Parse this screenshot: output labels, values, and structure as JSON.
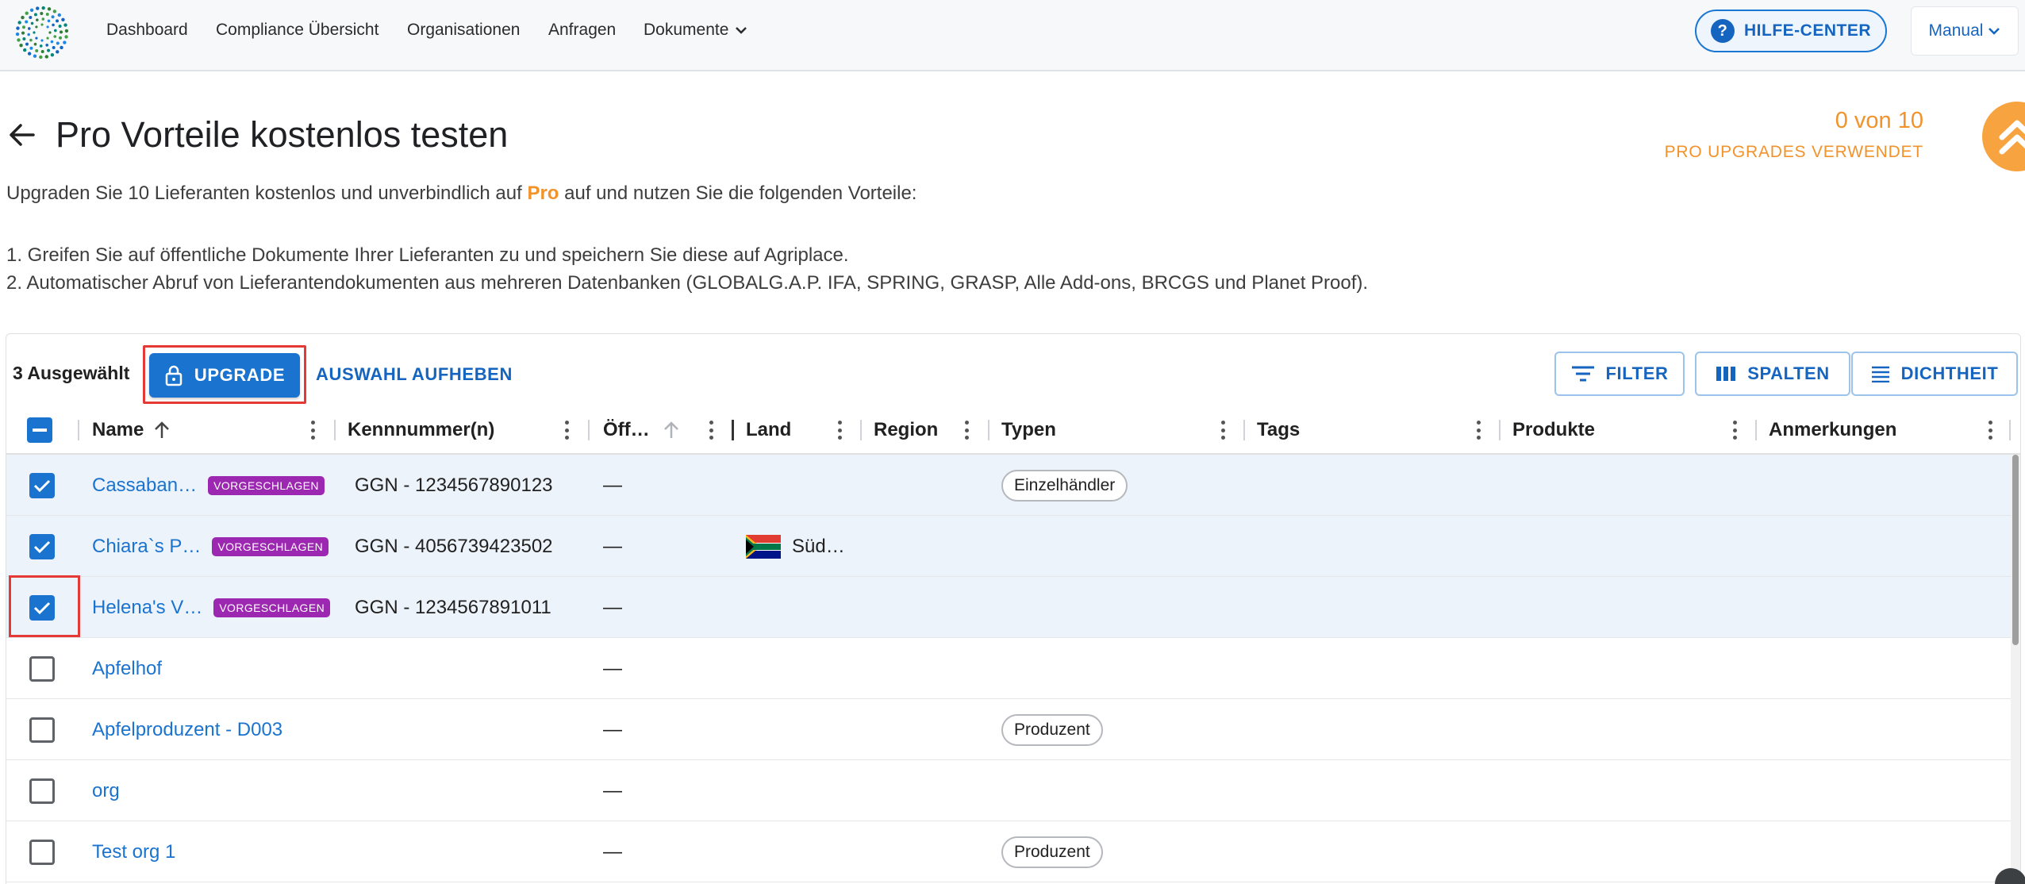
{
  "nav": {
    "items": [
      "Dashboard",
      "Compliance Übersicht",
      "Organisationen",
      "Anfragen",
      "Dokumente"
    ],
    "help_label": "HILFE-CENTER",
    "manual_label": "Manual"
  },
  "header": {
    "title": "Pro Vorteile kostenlos testen",
    "counter_value": "0 von 10",
    "counter_label": "PRO UPGRADES VERWENDET"
  },
  "intro": {
    "before": "Upgraden Sie 10 Lieferanten kostenlos und unverbindlich auf ",
    "pro": "Pro",
    "after": " auf und nutzen Sie die folgenden Vorteile:",
    "point1": "1. Greifen Sie auf öffentliche Dokumente Ihrer Lieferanten zu und speichern Sie diese auf Agriplace.",
    "point2": "2. Automatischer Abruf von Lieferantendokumenten aus mehreren Datenbanken (GLOBALG.A.P. IFA, SPRING, GRASP, Alle Add-ons, BRCGS und Planet Proof)."
  },
  "toolbar": {
    "selected_count": "3 Ausgewählt",
    "upgrade_label": "UPGRADE",
    "clear_label": "AUSWAHL AUFHEBEN",
    "filter_label": "FILTER",
    "columns_label": "SPALTEN",
    "density_label": "DICHTHEIT"
  },
  "columns": [
    "Name",
    "Kennnummer(n)",
    "Öff…",
    "Land",
    "Region",
    "Typen",
    "Tags",
    "Produkte",
    "Anmerkungen"
  ],
  "rows": [
    {
      "name": "Cassaban…",
      "badge": "VORGESCHLAGEN",
      "id": "GGN - 1234567890123",
      "pub": "—",
      "land": "",
      "typ": "Einzelhändler",
      "checked": true
    },
    {
      "name": "Chiara`s P…",
      "badge": "VORGESCHLAGEN",
      "id": "GGN - 4056739423502",
      "pub": "—",
      "land": "Süd…",
      "typ": "",
      "checked": true
    },
    {
      "name": "Helena's V…",
      "badge": "VORGESCHLAGEN",
      "id": "GGN - 1234567891011",
      "pub": "—",
      "land": "",
      "typ": "",
      "checked": true
    },
    {
      "name": "Apfelhof",
      "badge": "",
      "id": "",
      "pub": "—",
      "land": "",
      "typ": "",
      "checked": false
    },
    {
      "name": "Apfelproduzent - D003",
      "badge": "",
      "id": "",
      "pub": "—",
      "land": "",
      "typ": "Produzent",
      "checked": false
    },
    {
      "name": "org",
      "badge": "",
      "id": "",
      "pub": "—",
      "land": "",
      "typ": "",
      "checked": false
    },
    {
      "name": "Test org 1",
      "badge": "",
      "id": "",
      "pub": "—",
      "land": "",
      "typ": "Produzent",
      "checked": false
    }
  ],
  "colors": {
    "accent": "#1a73cf",
    "orange": "#f2922b",
    "badge": "#9c27b0",
    "highlight": "#e53935"
  }
}
